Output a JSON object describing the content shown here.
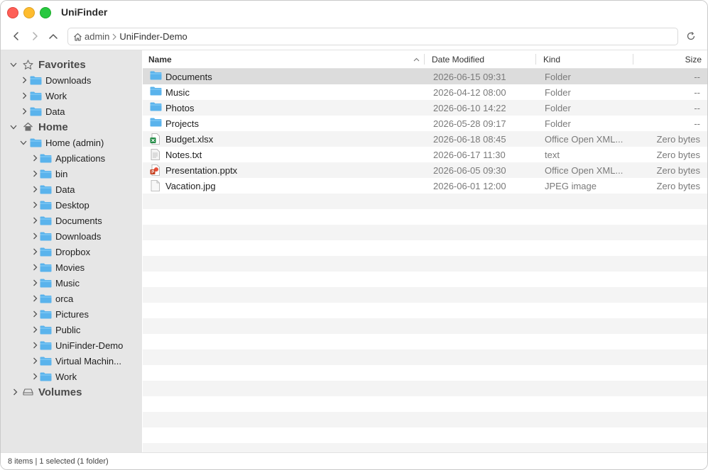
{
  "app": {
    "title": "UniFinder"
  },
  "toolbar": {
    "path": [
      "admin",
      "UniFinder-Demo"
    ]
  },
  "sidebar": {
    "favorites": {
      "label": "Favorites",
      "items": [
        {
          "label": "Downloads"
        },
        {
          "label": "Work"
        },
        {
          "label": "Data"
        }
      ]
    },
    "home": {
      "label": "Home",
      "root": {
        "label": "Home (admin)"
      },
      "items": [
        {
          "label": "Applications"
        },
        {
          "label": "bin"
        },
        {
          "label": "Data"
        },
        {
          "label": "Desktop"
        },
        {
          "label": "Documents"
        },
        {
          "label": "Downloads"
        },
        {
          "label": "Dropbox"
        },
        {
          "label": "Movies"
        },
        {
          "label": "Music"
        },
        {
          "label": "orca"
        },
        {
          "label": "Pictures"
        },
        {
          "label": "Public"
        },
        {
          "label": "UniFinder-Demo"
        },
        {
          "label": "Virtual Machin..."
        },
        {
          "label": "Work"
        }
      ]
    },
    "volumes": {
      "label": "Volumes"
    }
  },
  "columns": {
    "name": "Name",
    "date": "Date Modified",
    "kind": "Kind",
    "size": "Size"
  },
  "files": [
    {
      "name": "Documents",
      "date": "2026-06-15 09:31",
      "kind": "Folder",
      "size": "--",
      "icon": "folder-icon",
      "selected": true
    },
    {
      "name": "Music",
      "date": "2026-04-12 08:00",
      "kind": "Folder",
      "size": "--",
      "icon": "folder-icon"
    },
    {
      "name": "Photos",
      "date": "2026-06-10 14:22",
      "kind": "Folder",
      "size": "--",
      "icon": "folder-icon"
    },
    {
      "name": "Projects",
      "date": "2026-05-28 09:17",
      "kind": "Folder",
      "size": "--",
      "icon": "folder-icon"
    },
    {
      "name": "Budget.xlsx",
      "date": "2026-06-18 08:45",
      "kind": "Office Open XML...",
      "size": "Zero bytes",
      "icon": "excel-file-icon"
    },
    {
      "name": "Notes.txt",
      "date": "2026-06-17 11:30",
      "kind": "text",
      "size": "Zero bytes",
      "icon": "text-file-icon"
    },
    {
      "name": "Presentation.pptx",
      "date": "2026-06-05 09:30",
      "kind": "Office Open XML...",
      "size": "Zero bytes",
      "icon": "powerpoint-file-icon"
    },
    {
      "name": "Vacation.jpg",
      "date": "2026-06-01 12:00",
      "kind": "JPEG image",
      "size": "Zero bytes",
      "icon": "image-file-icon"
    }
  ],
  "status": {
    "text": "8 items | 1 selected (1 folder)"
  },
  "colors": {
    "folder": "#5ab3ec",
    "selection": "#dcdcdc",
    "sidebar_bg": "#e6e6e6"
  }
}
